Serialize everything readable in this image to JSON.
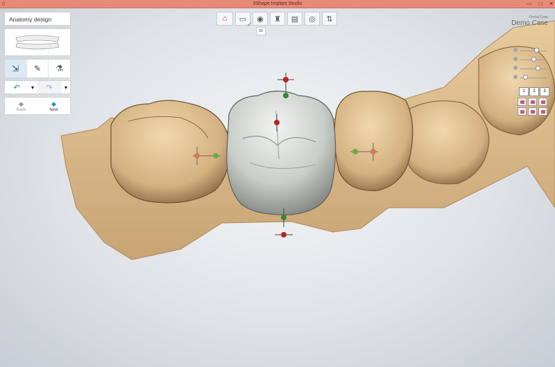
{
  "window": {
    "title": "3Shape Implant Studio",
    "controls": [
      "—",
      "□",
      "✕"
    ]
  },
  "left_panel": {
    "title": "Anatomy design",
    "tools": [
      "move-tool-icon",
      "pencil-tool-icon",
      "spray-tool-icon"
    ],
    "undo_symbol": "↶",
    "redo_symbol": "↷",
    "dropdown_symbol": "▾",
    "back_label": "Back",
    "next_label": "Next"
  },
  "toolbar": {
    "step_badge": "30",
    "check": "✓",
    "buttons": [
      "home-icon",
      "scan-icon",
      "tooth-icon",
      "implant-icon",
      "printer-icon",
      "disc-icon",
      "arrows-icon"
    ]
  },
  "info": {
    "case_id": "Dental Case",
    "patient": "Demo Case"
  },
  "right_controls": {
    "view_buttons": [
      "1",
      "2",
      "3"
    ],
    "slider_levels": [
      0.7,
      0.6,
      0.75,
      0.3
    ]
  },
  "colors": {
    "titlebar": "#e88a78",
    "gum": "#d9b98a",
    "crown": "#d0d3cf",
    "accent": "#2c87c8"
  }
}
